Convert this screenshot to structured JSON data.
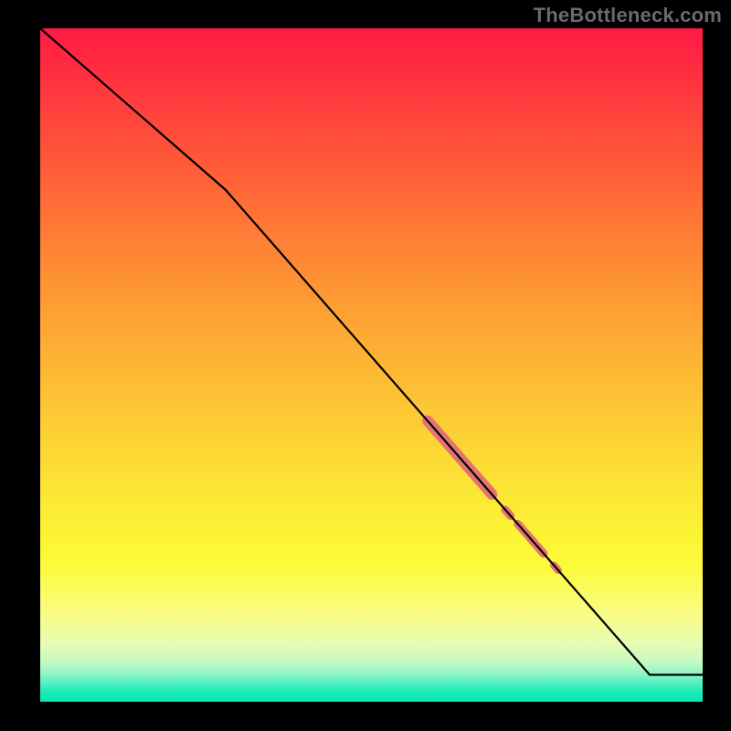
{
  "watermark": "TheBottleneck.com",
  "colors": {
    "highlight": "#e57373",
    "line": "#000000"
  },
  "chart_data": {
    "type": "line",
    "title": "",
    "xlabel": "",
    "ylabel": "",
    "xlim": [
      0,
      100
    ],
    "ylim": [
      0,
      100
    ],
    "x": [
      0,
      28,
      92,
      100
    ],
    "values": [
      100,
      76,
      4,
      4
    ],
    "highlight_segments": [
      {
        "x0": 58.5,
        "y0": 41.7,
        "x1": 68.2,
        "y1": 30.8,
        "width": 12
      },
      {
        "x0": 70.2,
        "y0": 28.5,
        "x1": 71.0,
        "y1": 27.6,
        "width": 9
      },
      {
        "x0": 72.1,
        "y0": 26.4,
        "x1": 76.0,
        "y1": 22.0,
        "width": 9
      },
      {
        "x0": 77.5,
        "y0": 20.3,
        "x1": 78.2,
        "y1": 19.5,
        "width": 8
      }
    ]
  }
}
